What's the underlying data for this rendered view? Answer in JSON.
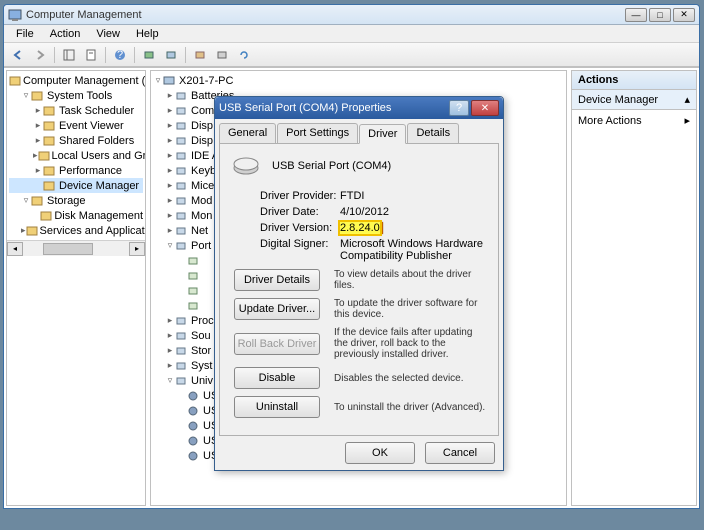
{
  "window": {
    "title": "Computer Management"
  },
  "menus": [
    "File",
    "Action",
    "View",
    "Help"
  ],
  "left_tree": [
    {
      "exp": "",
      "ind": 0,
      "label": "Computer Management (Local"
    },
    {
      "exp": "▿",
      "ind": 1,
      "label": "System Tools"
    },
    {
      "exp": "▸",
      "ind": 2,
      "label": "Task Scheduler"
    },
    {
      "exp": "▸",
      "ind": 2,
      "label": "Event Viewer"
    },
    {
      "exp": "▸",
      "ind": 2,
      "label": "Shared Folders"
    },
    {
      "exp": "▸",
      "ind": 2,
      "label": "Local Users and Groups"
    },
    {
      "exp": "▸",
      "ind": 2,
      "label": "Performance"
    },
    {
      "exp": "",
      "ind": 2,
      "label": "Device Manager",
      "sel": true
    },
    {
      "exp": "▿",
      "ind": 1,
      "label": "Storage"
    },
    {
      "exp": "",
      "ind": 2,
      "label": "Disk Management"
    },
    {
      "exp": "▸",
      "ind": 1,
      "label": "Services and Applications"
    }
  ],
  "mid_root": "X201-7-PC",
  "mid_tree": [
    {
      "exp": "▸",
      "label": "Batteries"
    },
    {
      "exp": "▸",
      "label": "Com"
    },
    {
      "exp": "▸",
      "label": "Disp"
    },
    {
      "exp": "▸",
      "label": "Disp"
    },
    {
      "exp": "▸",
      "label": "IDE A"
    },
    {
      "exp": "▸",
      "label": "Keyb"
    },
    {
      "exp": "▸",
      "label": "Mice"
    },
    {
      "exp": "▸",
      "label": "Mod"
    },
    {
      "exp": "▸",
      "label": "Mon"
    },
    {
      "exp": "▸",
      "label": "Net"
    },
    {
      "exp": "▿",
      "label": "Port"
    },
    {
      "exp": "▸",
      "label": "Proc"
    },
    {
      "exp": "▸",
      "label": "Sou"
    },
    {
      "exp": "▸",
      "label": "Stor"
    },
    {
      "exp": "▸",
      "label": "Syst"
    },
    {
      "exp": "▿",
      "label": "Univ"
    }
  ],
  "mid_usb": [
    "USB Composite Device",
    "USB Root Hub",
    "USB Root Hub",
    "USB Serial Converter A",
    "USB Serial Converter B"
  ],
  "actions": {
    "header": "Actions",
    "sub": "Device Manager",
    "more": "More Actions"
  },
  "dialog": {
    "title": "USB Serial Port (COM4) Properties",
    "tabs": [
      "General",
      "Port Settings",
      "Driver",
      "Details"
    ],
    "device_name": "USB Serial Port (COM4)",
    "rows": {
      "provider_label": "Driver Provider:",
      "provider_value": "FTDI",
      "date_label": "Driver Date:",
      "date_value": "4/10/2012",
      "version_label": "Driver Version:",
      "version_value": "2.8.24.0",
      "signer_label": "Digital Signer:",
      "signer_value": "Microsoft Windows Hardware Compatibility Publisher"
    },
    "buttons": {
      "details": "Driver Details",
      "details_desc": "To view details about the driver files.",
      "update": "Update Driver...",
      "update_desc": "To update the driver software for this device.",
      "rollback": "Roll Back Driver",
      "rollback_desc": "If the device fails after updating the driver, roll back to the previously installed driver.",
      "disable": "Disable",
      "disable_desc": "Disables the selected device.",
      "uninstall": "Uninstall",
      "uninstall_desc": "To uninstall the driver (Advanced)."
    },
    "ok": "OK",
    "cancel": "Cancel"
  }
}
